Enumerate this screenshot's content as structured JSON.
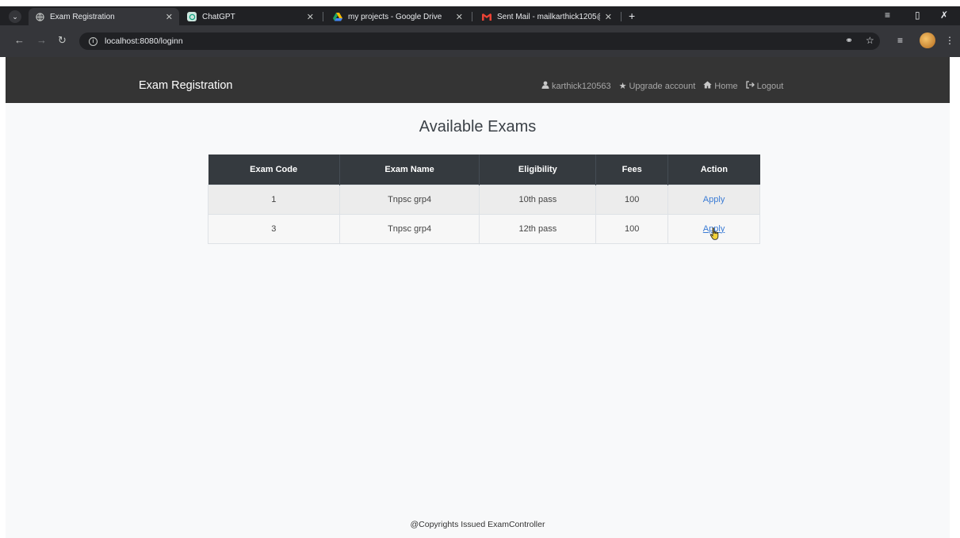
{
  "browser": {
    "tabs": [
      {
        "title": "Exam Registration",
        "icon": "globe-icon",
        "active": true
      },
      {
        "title": "ChatGPT",
        "icon": "chatgpt-icon",
        "active": false
      },
      {
        "title": "my projects - Google Drive",
        "icon": "google-drive-icon",
        "active": false
      },
      {
        "title": "Sent Mail - mailkarthick1205@",
        "icon": "gmail-icon",
        "active": false
      }
    ],
    "url": "localhost:8080/loginn"
  },
  "navbar": {
    "brand": "Exam Registration",
    "links": [
      {
        "label": "karthick120563",
        "icon": "user-icon"
      },
      {
        "label": "Upgrade account",
        "icon": "star-icon"
      },
      {
        "label": "Home",
        "icon": "home-icon"
      },
      {
        "label": "Logout",
        "icon": "logout-icon"
      }
    ]
  },
  "main": {
    "title": "Available Exams",
    "table": {
      "headers": [
        "Exam Code",
        "Exam Name",
        "Eligibility",
        "Fees",
        "Action"
      ],
      "rows": [
        {
          "code": "1",
          "name": "Tnpsc grp4",
          "eligibility": "10th pass",
          "fees": "100",
          "action": "Apply"
        },
        {
          "code": "3",
          "name": "Tnpsc grp4",
          "eligibility": "12th pass",
          "fees": "100",
          "action": "Apply"
        }
      ]
    }
  },
  "footer": {
    "text": "@Copyrights Issued ExamController"
  },
  "colors": {
    "navbar": "#343434",
    "table_header": "#353a3f",
    "link": "#3a7bd5",
    "page_bg": "#f8f9fa"
  }
}
